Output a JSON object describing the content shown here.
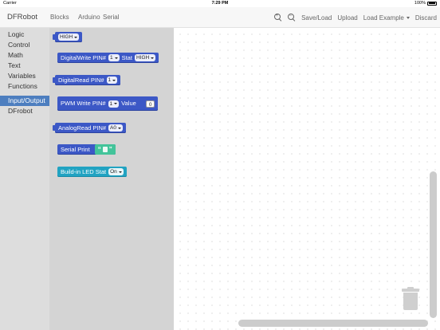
{
  "status_bar": {
    "carrier": "Carrier",
    "time": "7:29 PM",
    "battery": "100%"
  },
  "topbar": {
    "brand": "DFRobot",
    "nav": [
      "Blocks",
      "Arduino",
      "Serial"
    ],
    "zoom_in_icon": "zoom-in-icon",
    "zoom_out_icon": "zoom-out-icon",
    "save_load": "Save/Load",
    "upload": "Upload",
    "load_example": "Load Example",
    "discard": "Discard"
  },
  "sidebar": {
    "items": [
      {
        "label": "Logic"
      },
      {
        "label": "Control"
      },
      {
        "label": "Math"
      },
      {
        "label": "Text"
      },
      {
        "label": "Variables"
      },
      {
        "label": "Functions"
      },
      {
        "label": "Input/Output",
        "selected": true
      },
      {
        "label": "DFrobot"
      }
    ]
  },
  "blocks": {
    "high": {
      "value": "HIGH"
    },
    "digital_write": {
      "label": "DigitalWrite PIN#",
      "pin": "1",
      "stat_label": "Stat",
      "stat": "HIGH"
    },
    "digital_read": {
      "label": "DigitalRead PIN#",
      "pin": "1"
    },
    "pwm_write": {
      "label": "PWM Write PIN#",
      "pin": "1",
      "value_label": "Value",
      "value": "0"
    },
    "analog_read": {
      "label": "AnalogRead PIN#",
      "pin": "A0"
    },
    "serial_print": {
      "label": "Serial Print",
      "open_quote": "“",
      "close_quote": "”"
    },
    "led_stat": {
      "label": "Build-in LED Stat",
      "value": "On"
    }
  },
  "colors": {
    "block_blue": "#3c58c6",
    "block_teal": "#21a3c2",
    "text_green": "#43c49a",
    "selected": "#4d7ebf"
  }
}
